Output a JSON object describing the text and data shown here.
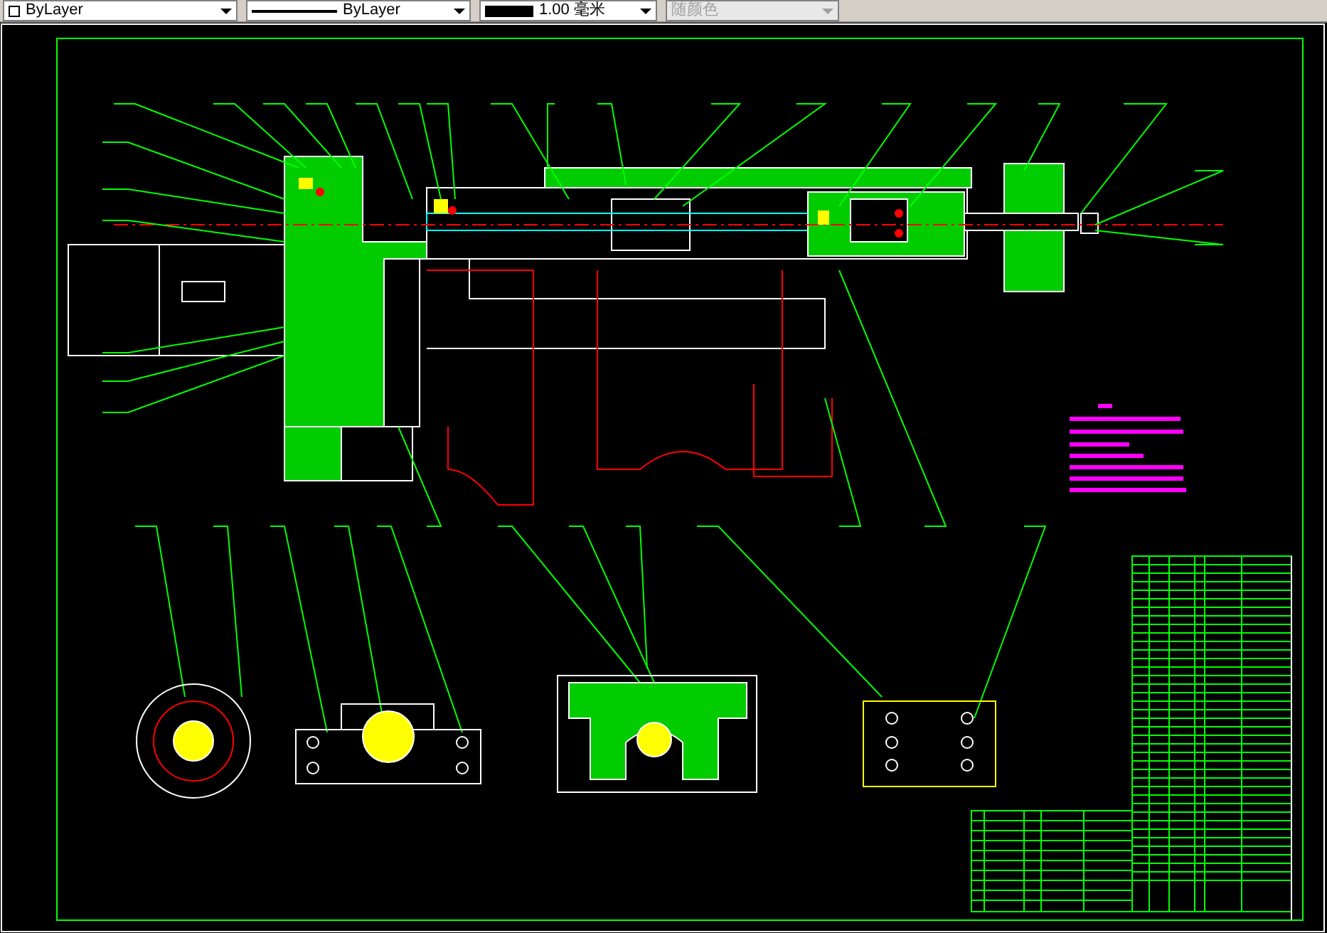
{
  "toolbar": {
    "controls": [
      {
        "kind": "layer",
        "value": "ByLayer",
        "disabled": false
      },
      {
        "kind": "linetype",
        "value": "ByLayer",
        "disabled": false
      },
      {
        "kind": "lineweight",
        "value": "1.00 毫米",
        "disabled": false
      },
      {
        "kind": "plotstyle",
        "value": "随颜色",
        "disabled": true
      }
    ]
  }
}
